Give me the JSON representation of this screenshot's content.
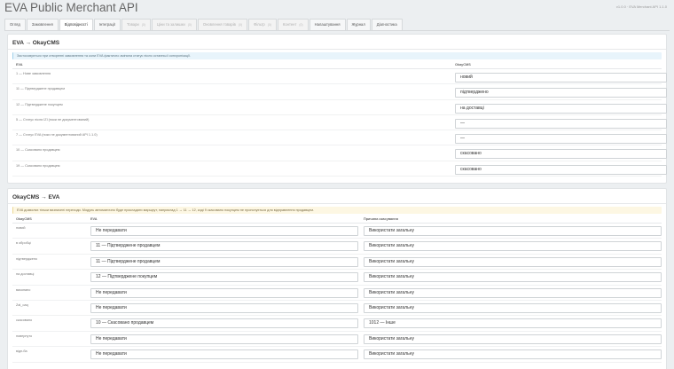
{
  "header": {
    "title": "EVA Public Merchant API",
    "version": "v1.0.0 · EVA Merchant API 1.1.0"
  },
  "tabs": [
    {
      "label": "Огляд",
      "state": "normal"
    },
    {
      "label": "Замовлення",
      "state": "normal"
    },
    {
      "label": "Відповідності",
      "state": "active"
    },
    {
      "label": "Інтеграції",
      "state": "normal"
    },
    {
      "label": "Товари",
      "badge": "(0)",
      "state": "disabled"
    },
    {
      "label": "Ціни та залишки",
      "badge": "(0)",
      "state": "disabled"
    },
    {
      "label": "Оновлення товарів",
      "badge": "(0)",
      "state": "disabled"
    },
    {
      "label": "Фільтр",
      "badge": "(0)",
      "state": "disabled"
    },
    {
      "label": "Контент",
      "badge": "(0)",
      "state": "disabled"
    },
    {
      "label": "Налаштування",
      "state": "normal"
    },
    {
      "label": "Журнал",
      "state": "normal"
    },
    {
      "label": "Діагностика",
      "state": "normal"
    }
  ],
  "eva_to_okay": {
    "title": "EVA → OkayCMS",
    "info": "Застосовується при створенні замовлення та коли EVA фактично змінила статус після останньої синхронізації.",
    "col_eva": "EVA",
    "col_okay": "OkayCMS",
    "rows": [
      {
        "label": "1 — Нове замовлення",
        "value": "новий"
      },
      {
        "label": "11 — Підтверджене продавцем",
        "value": "підтверджено"
      },
      {
        "label": "12 — Підтверджене покупцем",
        "value": "на доставці"
      },
      {
        "label": "5 — Статус після IZI (поки не документований)",
        "value": "—"
      },
      {
        "label": "7 — Статус EVA (поки не документований API 1.1.0)",
        "value": "—"
      },
      {
        "label": "10 — Скасовано продавцем",
        "value": "скасовано"
      },
      {
        "label": "19 — Скасовано продавцем",
        "value": "скасовано"
      }
    ]
  },
  "okay_to_eva": {
    "title": "OkayCMS → EVA",
    "info": "EVA дозволяє тільки визначені переходи. Модуль автоматично буде прокладати маршрут, наприклад 1 → 11 → 12, коді 9 скасовано покупцем не пропонується для відправлення продавцем.",
    "col_okay": "OkayCMS",
    "col_eva": "EVA",
    "col_reason": "Причина скасування",
    "rows": [
      {
        "label": "новий",
        "eva": "Не передавати",
        "reason": "Використати загальну"
      },
      {
        "label": "в обробці",
        "eva": "11 — Підтверджене продавцем",
        "reason": "Використати загальну"
      },
      {
        "label": "підтверджено",
        "eva": "11 — Підтверджене продавцем",
        "reason": "Використати загальну"
      },
      {
        "label": "на доставці",
        "eva": "12 — Підтверджене покупцем",
        "reason": "Використати загальну"
      },
      {
        "label": "виконано",
        "eva": "Не передавати",
        "reason": "Використати загальну"
      },
      {
        "label": "Zal_oaq",
        "eva": "Не передавати",
        "reason": "Використати загальну"
      },
      {
        "label": "скасовано",
        "eva": "10 — Скасовано продавцем",
        "reason": "1012 — Інше"
      },
      {
        "label": "повернуто",
        "eva": "Не передавати",
        "reason": "Використати загальну"
      },
      {
        "label": "відп-ба",
        "eva": "Не передавати",
        "reason": "Використати загальну"
      }
    ]
  }
}
